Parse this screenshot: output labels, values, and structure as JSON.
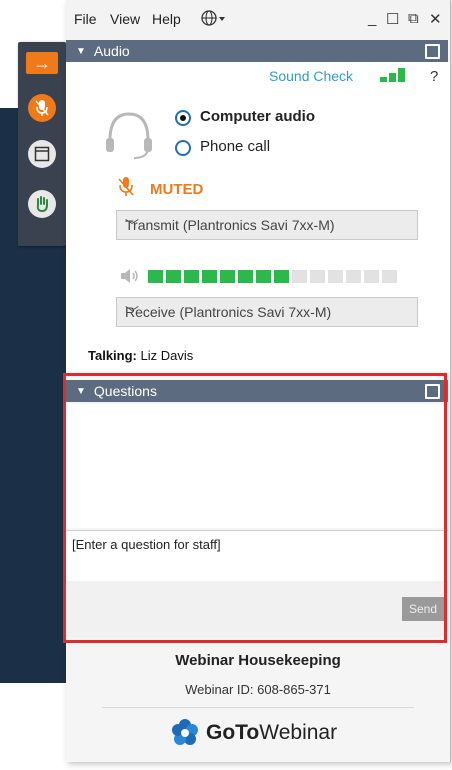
{
  "menu": {
    "file": "File",
    "view": "View",
    "help": "Help"
  },
  "window_controls": {
    "minimize": "_",
    "maximize": "☐",
    "restore": "⧉",
    "close": "✕"
  },
  "audio": {
    "header": "Audio",
    "sound_check": "Sound Check",
    "help": "?",
    "computer_audio": "Computer audio",
    "phone_call": "Phone call",
    "selected": "Computer audio",
    "status": "MUTED",
    "transmit_device": "Transmit (Plantronics Savi 7xx-M)",
    "receive_device": "Receive (Plantronics Savi 7xx-M)",
    "level_total": 14,
    "level_active": 8,
    "talking_label": "Talking:",
    "talking_name": "Liz Davis"
  },
  "questions": {
    "header": "Questions",
    "placeholder": "[Enter a question for staff]",
    "send_label": "Send"
  },
  "footer": {
    "title": "Webinar Housekeeping",
    "webinar_id": "Webinar ID: 608-865-371",
    "logo_goto": "GoTo",
    "logo_webinar": "Webinar"
  },
  "colors": {
    "accent_orange": "#f07a1a",
    "header_blue": "#5c6b80",
    "level_green": "#2db84b",
    "link_blue": "#2c9ed4",
    "highlight_red": "#e02b2b"
  }
}
